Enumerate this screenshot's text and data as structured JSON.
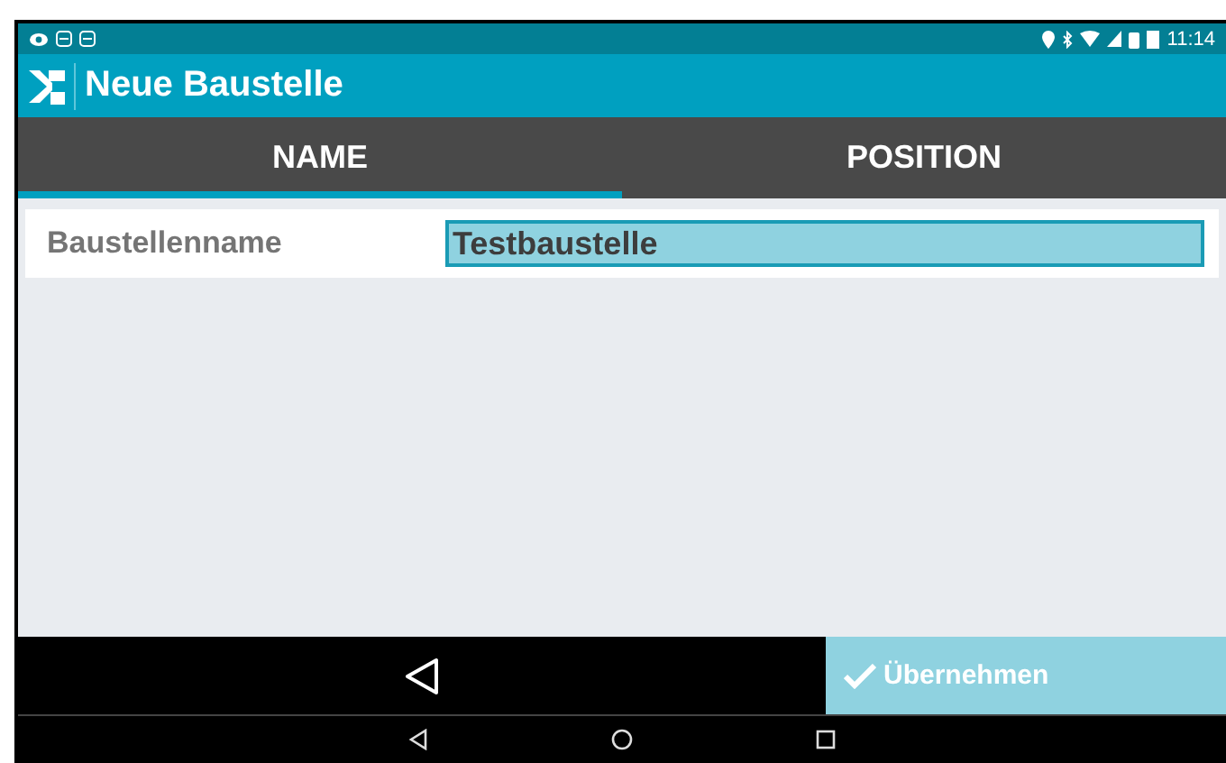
{
  "status_bar": {
    "time": "11:14"
  },
  "app_bar": {
    "title": "Neue Baustelle"
  },
  "tabs": [
    {
      "label": "NAME",
      "selected": true
    },
    {
      "label": "POSITION",
      "selected": false
    }
  ],
  "form": {
    "label": "Baustellenname",
    "value": "Testbaustelle"
  },
  "bottom_bar": {
    "confirm": "Übernehmen"
  }
}
